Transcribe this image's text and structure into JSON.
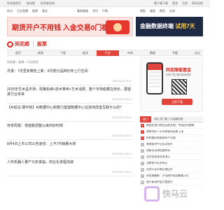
{
  "topbar": {
    "links": [
      "同花顺首页",
      "移动版",
      "投资者咨询"
    ],
    "right": [
      "客户端下载",
      "登录",
      "注册",
      "网站导航"
    ]
  },
  "subbar": {
    "left": [
      "热点",
      "正在直播",
      "股票",
      "基金"
    ],
    "mid": [
      "最新数据",
      "资讯",
      "行情"
    ],
    "right": [
      "港股",
      "美股",
      "期货",
      "全球"
    ]
  },
  "ads": {
    "left": "期货开户不用钱 入金交易0门槛",
    "right_prefix": "金融数据终端",
    "right_strong": "试用7天"
  },
  "header": {
    "brand": "同花顺",
    "section": "股票"
  },
  "nav": {
    "items": [
      "首页",
      "新闻",
      "个股",
      "板块",
      "行业",
      "市场",
      "数据",
      "专题",
      "论坛"
    ],
    "active_index": 4
  },
  "breadcrumb": "同花顺 > 股票 > 行业研究",
  "news": [
    {
      "title": "月报：7月里有哪些上新，8月部分品种仍存上行空间",
      "date": "2025-08-02 00:01"
    },
    {
      "title": "2025年艺术品市场：政策松绑+技术革命+艺术消费，整个市场稳着在增长，展望其行业未来",
      "date": "2025-08-02 00:01"
    },
    {
      "title": "【AI前沿·硬中软】AI数据中心和算力基建数据中心在如何改善互联什么的？",
      "date": "2025-08-02 00:01"
    },
    {
      "title": "存单周报：增值税调整以来的好时候",
      "date": "2025-08-02 00:01"
    },
    {
      "title": "8月4日上市公司公告速览：上汽7月销量大增",
      "date": "2025-08-02 00:01"
    },
    {
      "title": "人形机器人量产元年来临，商业化进程加速",
      "date": "2025-08-02 00:01"
    }
  ],
  "promo": {
    "title": "同花顺爱基金",
    "subtitle": "扫码下载 随时随地理财",
    "button": "立即下载"
  },
  "hot": {
    "label": "热门",
    "tags": "A股  |  热门股  |  7月量最热股",
    "items": [
      {
        "rank": "1",
        "title": "美国对进口商品征收关税，中国应对策略"
      },
      {
        "rank": "2",
        "title": "政策利好下半导体板块迎来上涨"
      },
      {
        "rank": "3",
        "title": "机构看好新能源车产业链"
      },
      {
        "rank": "4",
        "title": "券商板块午后异动拉升"
      },
      {
        "rank": "5",
        "title": "创新药出海加速布局"
      },
      {
        "rank": "6",
        "title": "北向资金连续净流入"
      },
      {
        "rank": "7",
        "title": "消费电子旺季将至"
      },
      {
        "rank": "8",
        "title": "光伏行业价格企稳回升"
      },
      {
        "rank": "9",
        "title": "同花顺最新：沪深两市成交额破万亿"
      },
      {
        "rank": "10",
        "title": "银行板块护盘力度加大"
      }
    ]
  },
  "watermark": "快马云"
}
